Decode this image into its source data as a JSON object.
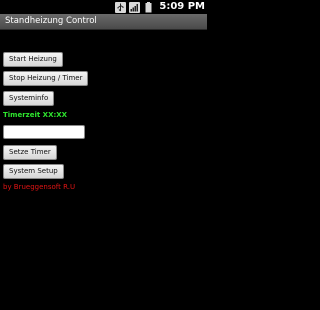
{
  "status_bar": {
    "time": "5:09 PM",
    "icons": [
      "usb-icon",
      "signal-icon",
      "battery-icon"
    ]
  },
  "title_bar": {
    "title": "Standheizung Control"
  },
  "buttons": {
    "start": "Start Heizung",
    "stop": "Stop Heizung / Timer",
    "sysinfo": "Systeminfo",
    "set_timer": "Setze Timer",
    "setup": "System Setup"
  },
  "timer": {
    "label": "Timerzeit XX:XX",
    "input_value": "",
    "input_placeholder": ""
  },
  "credit": "by Brueggensoft R.U",
  "colors": {
    "background": "#000000",
    "title_bar": "#5a5a5a",
    "timer_label": "#2ee52e",
    "credit": "#e01414"
  }
}
